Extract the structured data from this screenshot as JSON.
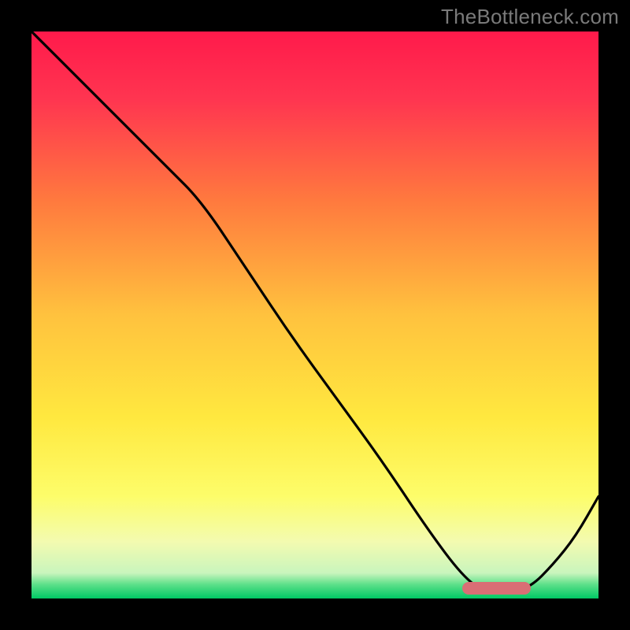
{
  "watermark": "TheBottleneck.com",
  "chart_data": {
    "type": "line",
    "title": "",
    "xlabel": "",
    "ylabel": "",
    "xlim": [
      0,
      100
    ],
    "ylim": [
      0,
      100
    ],
    "grid": false,
    "legend": false,
    "series": [
      {
        "name": "curve",
        "color": "#000000",
        "x": [
          0,
          8,
          16,
          24,
          30,
          38,
          46,
          54,
          62,
          70,
          76,
          80,
          84,
          88,
          92,
          96,
          100
        ],
        "y": [
          100,
          92,
          84,
          76,
          70,
          58,
          46,
          35,
          24,
          12,
          4,
          1,
          1,
          2,
          6,
          11,
          18
        ]
      }
    ],
    "background_gradient": {
      "stops": [
        {
          "pos": 0.0,
          "color": "#ff1a4b"
        },
        {
          "pos": 0.12,
          "color": "#ff3550"
        },
        {
          "pos": 0.3,
          "color": "#ff7a3e"
        },
        {
          "pos": 0.5,
          "color": "#ffc23e"
        },
        {
          "pos": 0.68,
          "color": "#ffe83f"
        },
        {
          "pos": 0.82,
          "color": "#fdfd6a"
        },
        {
          "pos": 0.9,
          "color": "#f3fbb0"
        },
        {
          "pos": 0.955,
          "color": "#c9f5bd"
        },
        {
          "pos": 0.975,
          "color": "#5ee08a"
        },
        {
          "pos": 1.0,
          "color": "#00c864"
        }
      ]
    },
    "marker": {
      "x_start": 76,
      "x_end": 88,
      "y": 1.8,
      "color": "#d96e75"
    }
  }
}
